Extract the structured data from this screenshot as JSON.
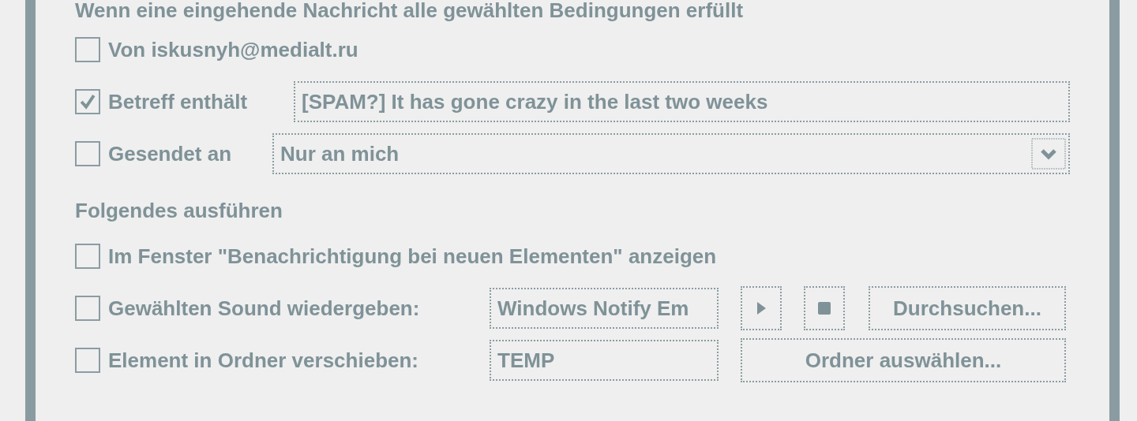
{
  "heading": "Wenn eine eingehende Nachricht alle gewählten Bedingungen erfüllt",
  "conditions": [
    {
      "kind": "plain",
      "label": "Von iskusnyh@medialt.ru",
      "checked": false
    },
    {
      "kind": "text",
      "label": "Betreff enthält",
      "checked": true,
      "value": "[SPAM?] It has gone crazy in the last two weeks"
    },
    {
      "kind": "dropdown",
      "label": "Gesendet an",
      "checked": false,
      "value": "Nur an mich"
    }
  ],
  "actions_heading": "Folgendes ausführen",
  "actions": [
    {
      "kind": "plain",
      "label": "Im Fenster \"Benachrichtigung bei neuen Elementen\" anzeigen",
      "checked": false
    },
    {
      "kind": "sound",
      "label": "Gewählten Sound wiedergeben:",
      "checked": false,
      "value": "Windows Notify Em",
      "button": "Durchsuchen..."
    },
    {
      "kind": "folder",
      "label": "Element in Ordner verschieben:",
      "checked": false,
      "value": "TEMP",
      "button": "Ordner auswählen..."
    }
  ]
}
